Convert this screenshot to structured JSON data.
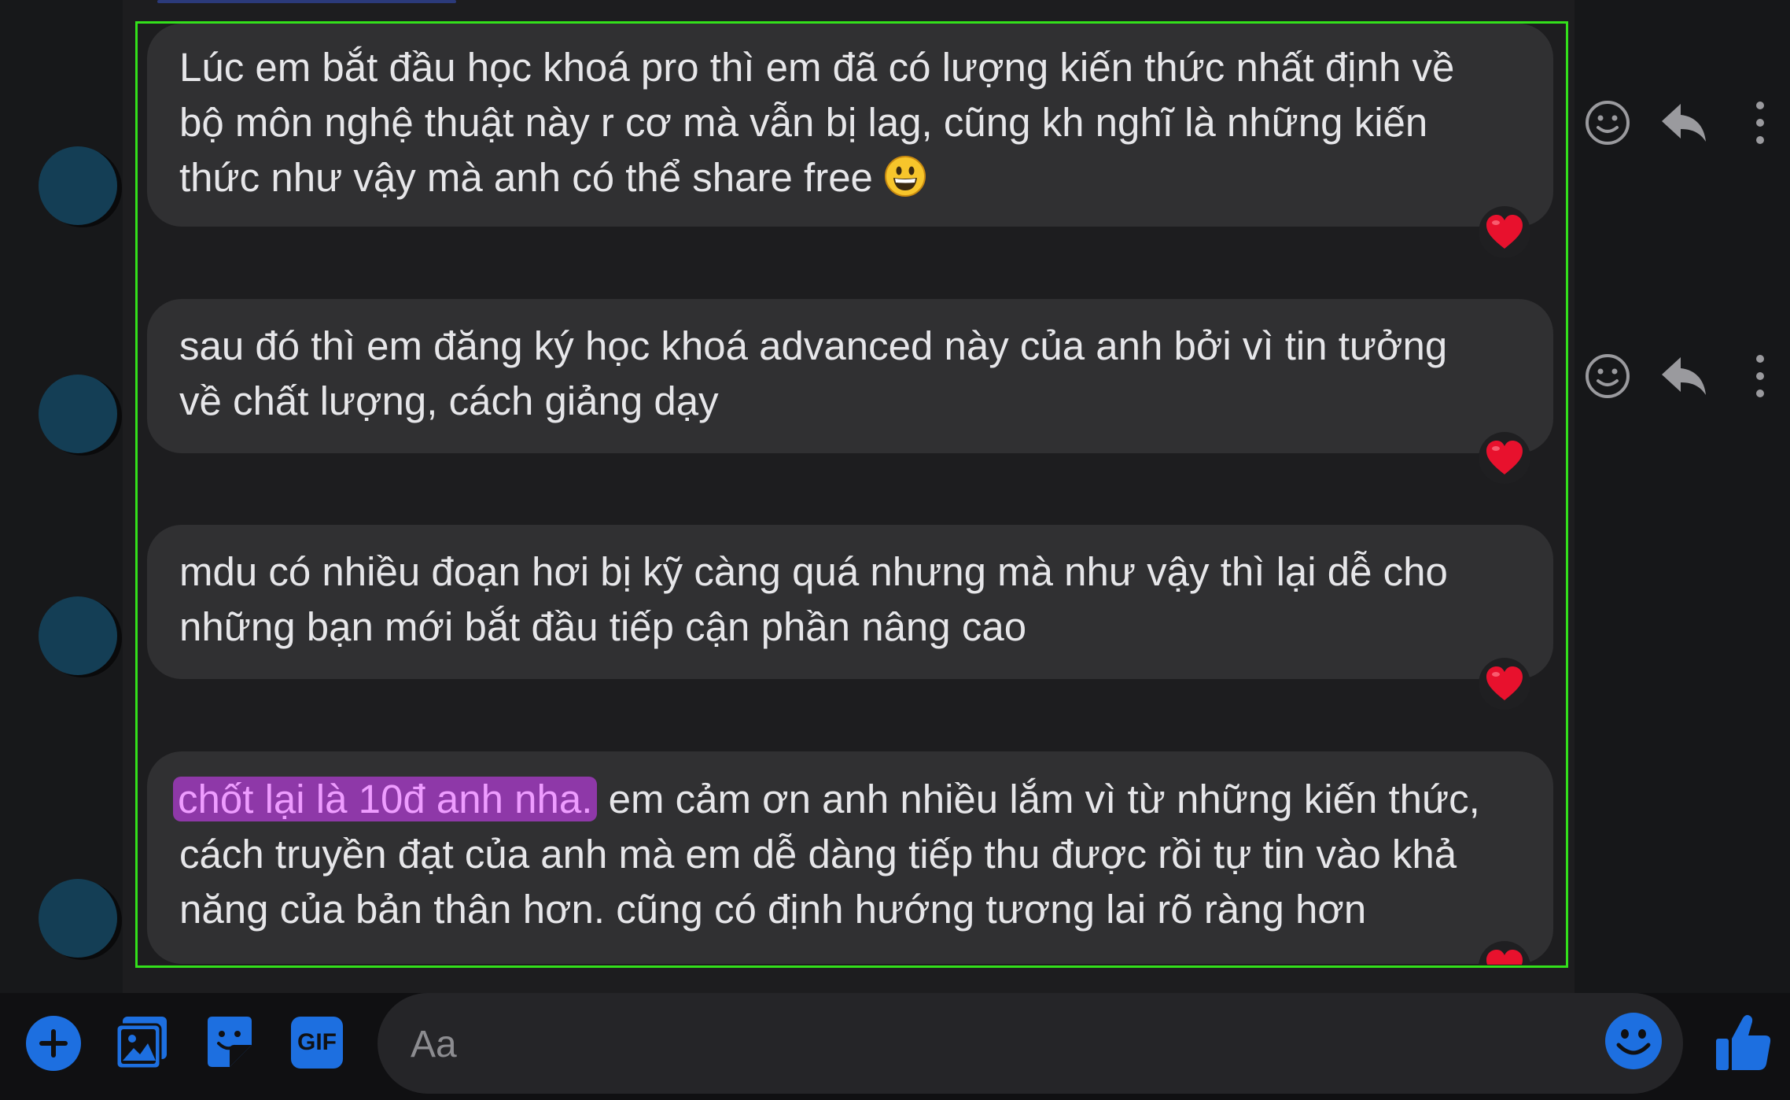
{
  "messages": [
    {
      "text": "Lúc em bắt đầu học khoá pro thì em đã có lượng kiến thức nhất định về\nbộ môn nghệ thuật này r cơ mà vẫn bị lag, cũng kh nghĩ là những kiến\nthức như vậy mà anh có thể share free ",
      "emoji": "grinning-face-emoji",
      "reaction": "heart"
    },
    {
      "text": "sau đó thì em đăng ký học khoá advanced này của anh bởi vì tin tưởng\nvề chất lượng, cách giảng dạy",
      "reaction": "heart"
    },
    {
      "text": "mdu có nhiều đoạn hơi bị kỹ càng quá nhưng mà như vậy thì lại dễ cho\nnhững bạn mới bắt đầu tiếp cận phần nâng cao",
      "reaction": "heart"
    },
    {
      "highlight": "chốt lại là 10đ anh nha.",
      "text": " em cảm ơn anh nhiều lắm vì từ những kiến thức,\ncách truyền đạt của anh mà em dễ dàng tiếp thu được rồi tự tin vào khả\nnăng của bản thân hơn. cũng có định hướng tương lai rõ ràng hơn",
      "reaction": "heart"
    }
  ],
  "message_actions": [
    "react-icon",
    "reply-icon",
    "more-icon"
  ],
  "composer": {
    "placeholder": "Aa",
    "icons": [
      "plus-icon",
      "photo-icon",
      "sticker-icon",
      "gif-icon",
      "emoji-icon",
      "like-icon"
    ],
    "gif_label": "GIF"
  },
  "colors": {
    "accent": "#1d6fe0",
    "highlight_bg": "#8e38a8",
    "highlight_text": "#ee9cff",
    "heart": "#e8112d",
    "selection_border": "#33e01b",
    "bubble": "#303032"
  }
}
